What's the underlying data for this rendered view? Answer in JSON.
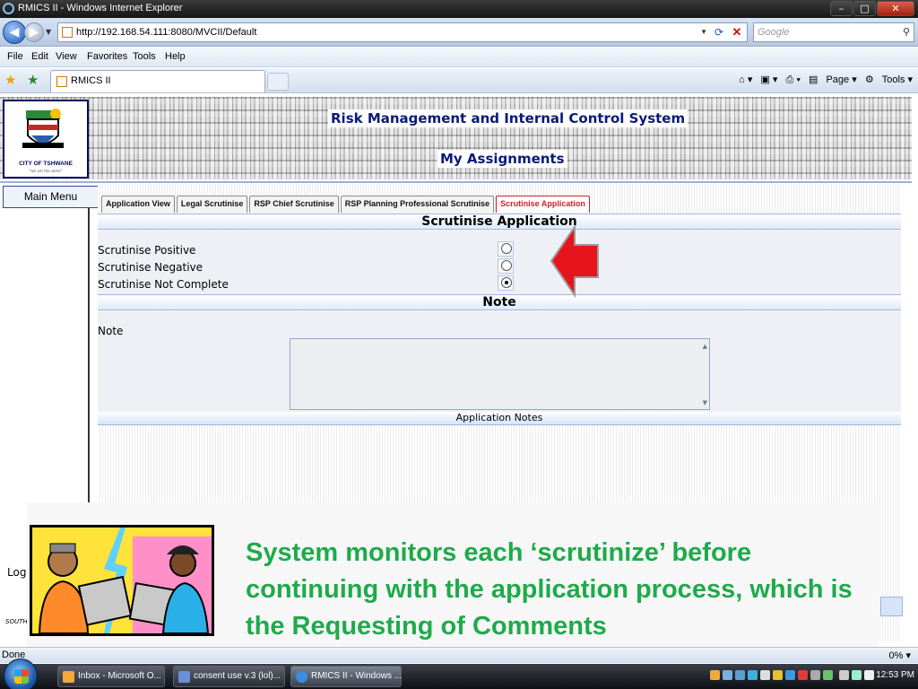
{
  "browser": {
    "window_title": "RMICS II - Windows Internet Explorer",
    "url": "http://192.168.54.111:8080/MVCII/Default",
    "search_placeholder": "Google",
    "menu": [
      "File",
      "Edit",
      "View",
      "Favorites",
      "Tools",
      "Help"
    ],
    "tab_title": "RMICS II",
    "command_bar": {
      "page": "Page",
      "tools": "Tools"
    },
    "status_left": "Done",
    "status_right": "0%"
  },
  "header": {
    "logo_text": "CITY OF TSHWANE",
    "logo_sub": "\"we are the same\"",
    "system_title": "Risk Management and Internal Control System",
    "page_title": "My Assignments"
  },
  "left_menu": {
    "main_menu": "Main Menu",
    "log_label": "Log",
    "south_label": "SOUTH"
  },
  "tabs": [
    {
      "label": "Application View",
      "active": false
    },
    {
      "label": "Legal Scrutinise",
      "active": false
    },
    {
      "label": "RSP Chief Scrutinise",
      "active": false
    },
    {
      "label": "RSP Planning Professional Scrutinise",
      "active": false
    },
    {
      "label": "Scrutinise Application",
      "active": true
    }
  ],
  "scrutinise": {
    "heading": "Scrutinise Application",
    "options": [
      {
        "label": "Scrutinise Positive",
        "checked": false
      },
      {
        "label": "Scrutinise Negative",
        "checked": false
      },
      {
        "label": "Scrutinise Not Complete",
        "checked": true
      }
    ]
  },
  "note": {
    "heading": "Note",
    "label": "Note",
    "value": "",
    "footer": "Application Notes"
  },
  "slide": {
    "caption": "System monitors each ‘scrutinize’ before continuing with the application process, which is the Requesting of Comments"
  },
  "taskbar": {
    "items": [
      {
        "label": "Inbox - Microsoft O...",
        "active": false
      },
      {
        "label": "consent use v.3 (lol)...",
        "active": false
      },
      {
        "label": "RMICS II - Windows ...",
        "active": true
      }
    ],
    "clock": "12:53 PM"
  },
  "colors": {
    "active_tab": "#d0202a",
    "title_blue": "#0a1a7a",
    "caption_green": "#1faa4b",
    "arrow_red": "#e8141b"
  }
}
